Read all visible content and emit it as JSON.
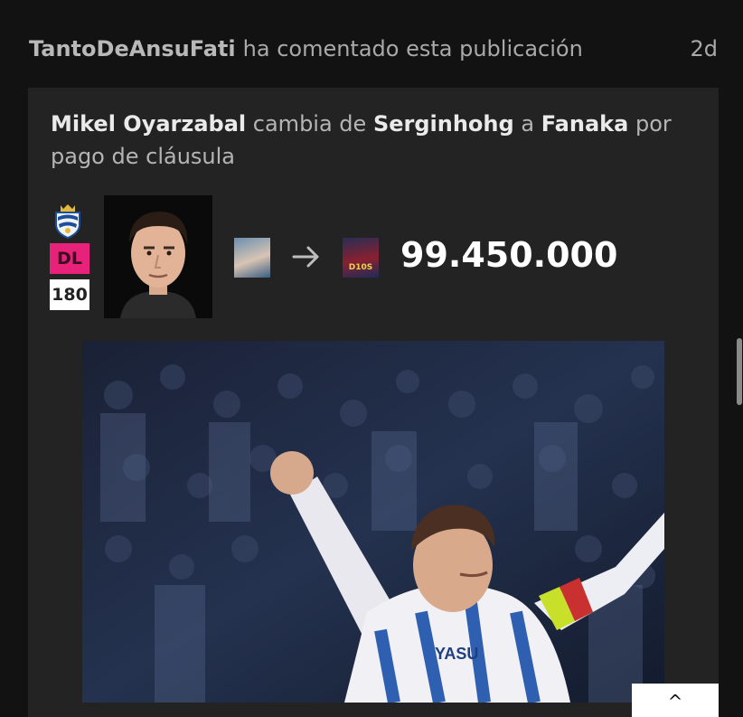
{
  "activity": {
    "user": "TantoDeAnsuFati",
    "action": "ha comentado esta publicación",
    "time": "2d"
  },
  "post": {
    "player_name": "Mikel Oyarzabal",
    "text_changes": "cambia de",
    "from_user": "Serginhohg",
    "text_to": "a",
    "to_user": "Fanaka",
    "text_reason": "por pago de cláusula",
    "position": "DL",
    "points": "180",
    "price": "99.450.000",
    "to_avatar_text": "D10S",
    "club_crest_icon": "real-sociedad-crest",
    "position_color": "#e8217a"
  },
  "corner_button": {
    "label": "^"
  }
}
